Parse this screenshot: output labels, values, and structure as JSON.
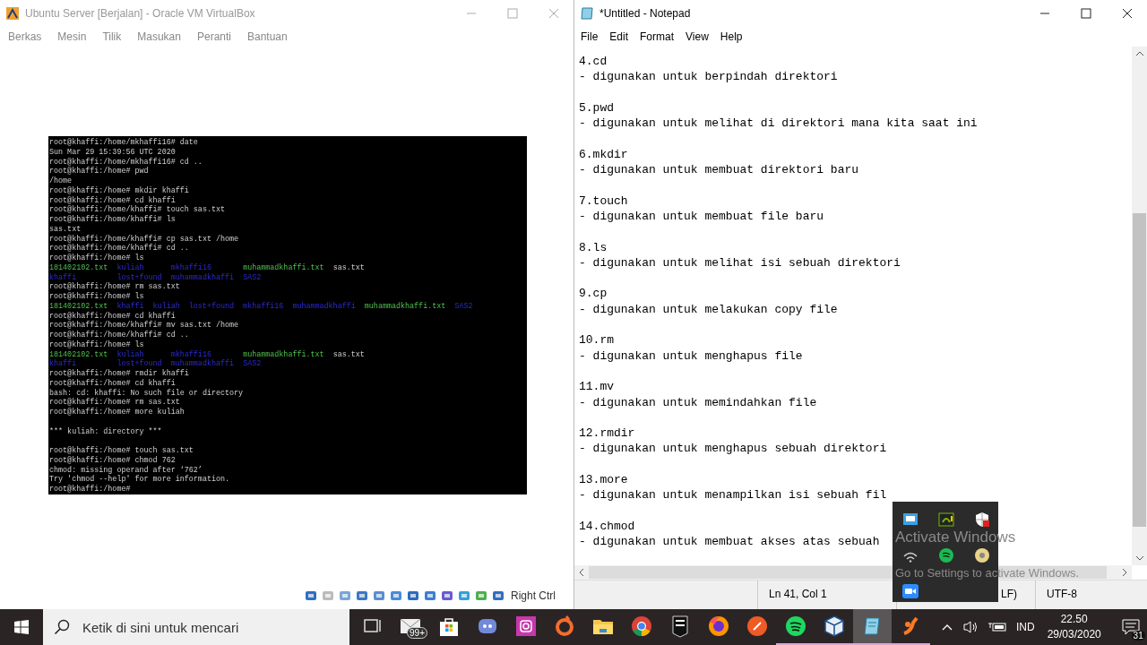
{
  "virtualbox": {
    "title": "Ubuntu Server [Berjalan] - Oracle VM VirtualBox",
    "menu": [
      "Berkas",
      "Mesin",
      "Tilik",
      "Masukan",
      "Peranti",
      "Bantuan"
    ],
    "terminal": {
      "lines": [
        {
          "kind": "text",
          "text": "root@khaffi:/home/mkhaffi16# date"
        },
        {
          "kind": "text",
          "text": "Sun Mar 29 15:39:56 UTC 2020"
        },
        {
          "kind": "text",
          "text": "root@khaffi:/home/mkhaffi16# cd .."
        },
        {
          "kind": "text",
          "text": "root@khaffi:/home# pwd"
        },
        {
          "kind": "text",
          "text": "/home"
        },
        {
          "kind": "text",
          "text": "root@khaffi:/home# mkdir khaffi"
        },
        {
          "kind": "text",
          "text": "root@khaffi:/home# cd khaffi"
        },
        {
          "kind": "text",
          "text": "root@khaffi:/home/khaffi# touch sas.txt"
        },
        {
          "kind": "text",
          "text": "root@khaffi:/home/khaffi# ls"
        },
        {
          "kind": "text",
          "text": "sas.txt"
        },
        {
          "kind": "text",
          "text": "root@khaffi:/home/khaffi# cp sas.txt /home"
        },
        {
          "kind": "text",
          "text": "root@khaffi:/home/khaffi# cd .."
        },
        {
          "kind": "text",
          "text": "root@khaffi:/home# ls"
        },
        {
          "kind": "ls",
          "rows": [
            [
              {
                "text": "181402102.txt",
                "kind": "exec"
              },
              {
                "text": "kuliah",
                "kind": "dir"
              },
              {
                "text": "mkhaffi16",
                "kind": "dir"
              },
              {
                "text": "muhammadkhaffi.txt",
                "kind": "exec"
              },
              {
                "text": "sas.txt",
                "kind": "file"
              }
            ],
            [
              {
                "text": "khaffi",
                "kind": "dir"
              },
              {
                "text": "lost+found",
                "kind": "dir"
              },
              {
                "text": "muhammadkhaffi",
                "kind": "dir"
              },
              {
                "text": "SAS2",
                "kind": "dir"
              }
            ]
          ]
        },
        {
          "kind": "text",
          "text": "root@khaffi:/home# rm sas.txt"
        },
        {
          "kind": "text",
          "text": "root@khaffi:/home# ls"
        },
        {
          "kind": "ls",
          "rows": [
            [
              {
                "text": "181402102.txt",
                "kind": "exec"
              },
              {
                "text": "khaffi",
                "kind": "dir"
              },
              {
                "text": "kuliah",
                "kind": "dir"
              },
              {
                "text": "lost+found",
                "kind": "dir"
              },
              {
                "text": "mkhaffi16",
                "kind": "dir"
              },
              {
                "text": "muhammadkhaffi",
                "kind": "dir"
              },
              {
                "text": "muhammadkhaffi.txt",
                "kind": "exec"
              },
              {
                "text": "SAS2",
                "kind": "dir"
              }
            ]
          ]
        },
        {
          "kind": "text",
          "text": "root@khaffi:/home# cd khaffi"
        },
        {
          "kind": "text",
          "text": "root@khaffi:/home/khaffi# mv sas.txt /home"
        },
        {
          "kind": "text",
          "text": "root@khaffi:/home/khaffi# cd .."
        },
        {
          "kind": "text",
          "text": "root@khaffi:/home# ls"
        },
        {
          "kind": "ls",
          "rows": [
            [
              {
                "text": "181402102.txt",
                "kind": "exec"
              },
              {
                "text": "kuliah",
                "kind": "dir"
              },
              {
                "text": "mkhaffi16",
                "kind": "dir"
              },
              {
                "text": "muhammadkhaffi.txt",
                "kind": "exec"
              },
              {
                "text": "sas.txt",
                "kind": "file"
              }
            ],
            [
              {
                "text": "khaffi",
                "kind": "dir"
              },
              {
                "text": "lost+found",
                "kind": "dir"
              },
              {
                "text": "muhammadkhaffi",
                "kind": "dir"
              },
              {
                "text": "SAS2",
                "kind": "dir"
              }
            ]
          ]
        },
        {
          "kind": "text",
          "text": "root@khaffi:/home# rmdir khaffi"
        },
        {
          "kind": "text",
          "text": "root@khaffi:/home# cd khaffi"
        },
        {
          "kind": "text",
          "text": "bash: cd: khaffi: No such file or directory"
        },
        {
          "kind": "text",
          "text": "root@khaffi:/home# rm sas.txt"
        },
        {
          "kind": "text",
          "text": "root@khaffi:/home# more kuliah"
        },
        {
          "kind": "blank"
        },
        {
          "kind": "text",
          "text": "*** kuliah: directory ***"
        },
        {
          "kind": "blank"
        },
        {
          "kind": "text",
          "text": "root@khaffi:/home# touch sas.txt"
        },
        {
          "kind": "text",
          "text": "root@khaffi:/home# chmod 762"
        },
        {
          "kind": "text",
          "text": "chmod: missing operand after ‘762’"
        },
        {
          "kind": "text",
          "text": "Try 'chmod --help' for more information."
        },
        {
          "kind": "text",
          "text": "root@khaffi:/home#"
        }
      ]
    },
    "status_bar": {
      "host_key": "Right Ctrl"
    }
  },
  "notepad": {
    "title": "*Untitled - Notepad",
    "menu": [
      "File",
      "Edit",
      "Format",
      "View",
      "Help"
    ],
    "entries": [
      {
        "command": "4.cd",
        "description": "- digunakan untuk berpindah direktori"
      },
      {
        "command": "5.pwd",
        "description": "- digunakan untuk melihat di direktori mana kita saat ini"
      },
      {
        "command": "6.mkdir",
        "description": "- digunakan untuk membuat direktori baru"
      },
      {
        "command": "7.touch",
        "description": "- digunakan untuk membuat file baru"
      },
      {
        "command": "8.ls",
        "description": "- digunakan untuk melihat isi sebuah direktori"
      },
      {
        "command": "9.cp",
        "description": "- digunakan untuk melakukan copy file"
      },
      {
        "command": "10.rm",
        "description": "- digunakan untuk menghapus file"
      },
      {
        "command": "11.mv",
        "description": "- digunakan untuk memindahkan file"
      },
      {
        "command": "12.rmdir",
        "description": "- digunakan untuk menghapus sebuah direktori"
      },
      {
        "command": "13.more",
        "description": "- digunakan untuk menampilkan isi sebuah fil"
      },
      {
        "command": "14.chmod",
        "description": "- digunakan untuk membuat akses atas sebuah"
      }
    ],
    "status_bar": {
      "position": "Ln 41, Col 1",
      "line_ending": "LF)",
      "encoding": "UTF-8"
    }
  },
  "activation_notice": {
    "title": "Activate Windows",
    "subtitle": "Go to Settings to activate Windows."
  },
  "taskbar": {
    "search": {
      "placeholder": "Ketik di sini untuk mencari"
    },
    "apps": [
      {
        "kind": "task_view",
        "active": false,
        "running": false
      },
      {
        "kind": "mail",
        "badge": "99+",
        "active": false,
        "running": false
      },
      {
        "kind": "store",
        "active": false,
        "running": false
      },
      {
        "kind": "discord",
        "active": false,
        "running": false
      },
      {
        "kind": "instagram",
        "active": false,
        "running": false
      },
      {
        "kind": "origin",
        "active": false,
        "running": false
      },
      {
        "kind": "explorer",
        "active": false,
        "running": false
      },
      {
        "kind": "chrome",
        "active": false,
        "running": false
      },
      {
        "kind": "epic",
        "active": false,
        "running": false
      },
      {
        "kind": "firefox",
        "active": false,
        "running": false
      },
      {
        "kind": "postman",
        "active": false,
        "running": false
      },
      {
        "kind": "spotify",
        "active": false,
        "running": true
      },
      {
        "kind": "virtualbox",
        "active": false,
        "running": true
      },
      {
        "kind": "notepad",
        "active": true,
        "running": true
      },
      {
        "kind": "xampp",
        "active": false,
        "running": true
      }
    ],
    "tray": {
      "language": "IND",
      "time": "22.50",
      "date": "29/03/2020",
      "notifications": "31"
    }
  }
}
